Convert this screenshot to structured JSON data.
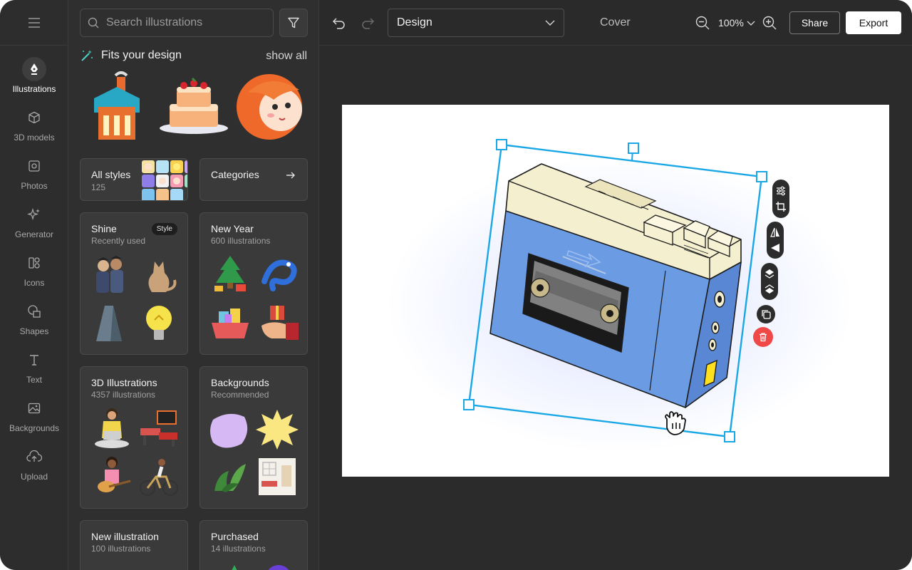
{
  "rail": {
    "items": [
      {
        "label": "Illustrations",
        "icon": "pen-nib-icon",
        "active": true
      },
      {
        "label": "3D models",
        "icon": "cube-icon"
      },
      {
        "label": "Photos",
        "icon": "photo-icon"
      },
      {
        "label": "Generator",
        "icon": "sparkle-icon"
      },
      {
        "label": "Icons",
        "icon": "icons-grid-icon"
      },
      {
        "label": "Shapes",
        "icon": "shapes-icon"
      },
      {
        "label": "Text",
        "icon": "text-t-icon"
      },
      {
        "label": "Backgrounds",
        "icon": "image-icon"
      },
      {
        "label": "Upload",
        "icon": "cloud-upload-icon"
      }
    ]
  },
  "panel": {
    "search_placeholder": "Search illustrations",
    "fits_title": "Fits your design",
    "show_all": "show all",
    "all_styles": {
      "title": "All styles",
      "count": "125"
    },
    "categories": {
      "title": "Categories"
    },
    "cards": [
      {
        "title": "Shine",
        "subtitle": "Recently used",
        "badge": "Style"
      },
      {
        "title": "New Year",
        "subtitle": "600 illustrations"
      },
      {
        "title": "3D Illustrations",
        "subtitle": "4357 illustrations"
      },
      {
        "title": "Backgrounds",
        "subtitle": "Recommended"
      },
      {
        "title": "New illustration",
        "subtitle": "100 illustrations"
      },
      {
        "title": "Purchased",
        "subtitle": "14 illustrations"
      }
    ]
  },
  "topbar": {
    "design_select": "Design",
    "page_label": "Cover",
    "zoom": "100%",
    "share": "Share",
    "export": "Export"
  },
  "colors": {
    "selection": "#1aa7e6",
    "device_blue": "#6b9be3",
    "device_cream": "#f4efcf",
    "delete_red": "#f04747"
  }
}
